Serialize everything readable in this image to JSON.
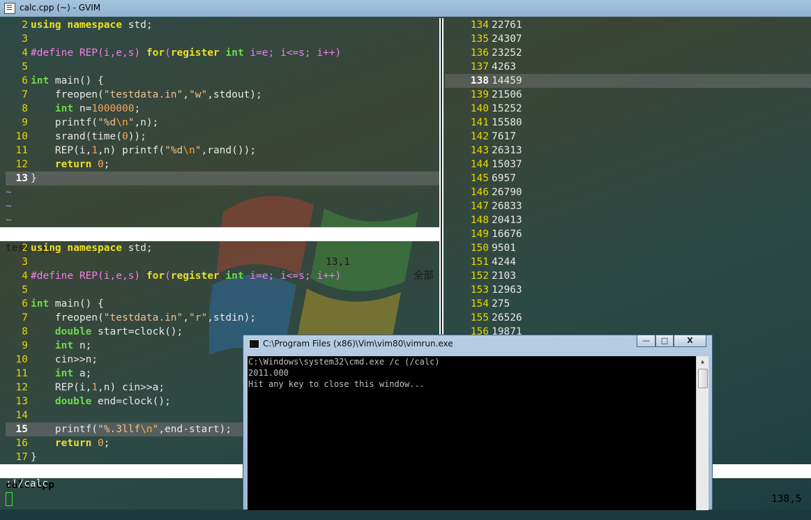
{
  "window": {
    "title": "calc.cpp (~) - GVIM"
  },
  "top_pane": {
    "lines": [
      {
        "n": "2",
        "tokens": [
          [
            "kw",
            "using"
          ],
          [
            "",
            " "
          ],
          [
            "kw",
            "namespace"
          ],
          [
            "",
            " std;"
          ]
        ]
      },
      {
        "n": "3",
        "tokens": []
      },
      {
        "n": "4",
        "tokens": [
          [
            "pp",
            "#define REP(i,e,s)"
          ],
          [
            "",
            " "
          ],
          [
            "kw",
            "for"
          ],
          [
            "pp",
            "("
          ],
          [
            "kw",
            "register"
          ],
          [
            "",
            " "
          ],
          [
            "ty",
            "int"
          ],
          [
            "pp",
            " i=e; i<=s; i++)"
          ]
        ]
      },
      {
        "n": "5",
        "tokens": []
      },
      {
        "n": "6",
        "tokens": [
          [
            "ty",
            "int"
          ],
          [
            "",
            " main() {"
          ]
        ]
      },
      {
        "n": "7",
        "tokens": [
          [
            "",
            "    freopen("
          ],
          [
            "str",
            "\"testdata.in\""
          ],
          [
            "",
            ","
          ],
          [
            "str",
            "\"w\""
          ],
          [
            "",
            ",stdout);"
          ]
        ]
      },
      {
        "n": "8",
        "tokens": [
          [
            "",
            "    "
          ],
          [
            "ty",
            "int"
          ],
          [
            "",
            " n="
          ],
          [
            "num",
            "1000000"
          ],
          [
            "",
            ";"
          ]
        ]
      },
      {
        "n": "9",
        "tokens": [
          [
            "",
            "    printf("
          ],
          [
            "str",
            "\"%d"
          ],
          [
            "esc",
            "\\n"
          ],
          [
            "str",
            "\""
          ],
          [
            "",
            ",n);"
          ]
        ]
      },
      {
        "n": "10",
        "tokens": [
          [
            "",
            "    srand(time("
          ],
          [
            "num",
            "0"
          ],
          [
            "",
            "));"
          ]
        ]
      },
      {
        "n": "11",
        "tokens": [
          [
            "",
            "    REP(i,"
          ],
          [
            "num",
            "1"
          ],
          [
            "",
            ",n) printf("
          ],
          [
            "str",
            "\"%d"
          ],
          [
            "esc",
            "\\n"
          ],
          [
            "str",
            "\""
          ],
          [
            "",
            ",rand());"
          ]
        ]
      },
      {
        "n": "12",
        "tokens": [
          [
            "",
            "    "
          ],
          [
            "kw",
            "return"
          ],
          [
            "",
            " "
          ],
          [
            "num",
            "0"
          ],
          [
            "",
            ";"
          ]
        ]
      },
      {
        "n": "13",
        "cur": true,
        "tokens": [
          [
            "",
            "}"
          ]
        ]
      }
    ],
    "tildes": [
      "~",
      "~",
      "~"
    ],
    "status": {
      "file": "test.cpp",
      "pos": "13,1",
      "all": "全部"
    }
  },
  "bottom_pane": {
    "lines": [
      {
        "n": "2",
        "tokens": [
          [
            "kw",
            "using"
          ],
          [
            "",
            " "
          ],
          [
            "kw",
            "namespace"
          ],
          [
            "",
            " std;"
          ]
        ]
      },
      {
        "n": "3",
        "tokens": []
      },
      {
        "n": "4",
        "tokens": [
          [
            "pp",
            "#define REP(i,e,s)"
          ],
          [
            "",
            " "
          ],
          [
            "kw",
            "for"
          ],
          [
            "pp",
            "("
          ],
          [
            "kw",
            "register"
          ],
          [
            "",
            " "
          ],
          [
            "ty",
            "int"
          ],
          [
            "pp",
            " i=e; i<=s; i++)"
          ]
        ]
      },
      {
        "n": "5",
        "tokens": []
      },
      {
        "n": "6",
        "tokens": [
          [
            "ty",
            "int"
          ],
          [
            "",
            " main() {"
          ]
        ]
      },
      {
        "n": "7",
        "tokens": [
          [
            "",
            "    freopen("
          ],
          [
            "str",
            "\"testdata.in\""
          ],
          [
            "",
            ","
          ],
          [
            "str",
            "\"r\""
          ],
          [
            "",
            ",stdin);"
          ]
        ]
      },
      {
        "n": "8",
        "tokens": [
          [
            "",
            "    "
          ],
          [
            "ty",
            "double"
          ],
          [
            "",
            " start=clock();"
          ]
        ]
      },
      {
        "n": "9",
        "tokens": [
          [
            "",
            "    "
          ],
          [
            "ty",
            "int"
          ],
          [
            "",
            " n;"
          ]
        ]
      },
      {
        "n": "10",
        "tokens": [
          [
            "",
            "    cin>>n;"
          ]
        ]
      },
      {
        "n": "11",
        "tokens": [
          [
            "",
            "    "
          ],
          [
            "ty",
            "int"
          ],
          [
            "",
            " a;"
          ]
        ]
      },
      {
        "n": "12",
        "tokens": [
          [
            "",
            "    REP(i,"
          ],
          [
            "num",
            "1"
          ],
          [
            "",
            ",n) cin>>a;"
          ]
        ]
      },
      {
        "n": "13",
        "tokens": [
          [
            "",
            "    "
          ],
          [
            "ty",
            "double"
          ],
          [
            "",
            " end=clock();"
          ]
        ]
      },
      {
        "n": "14",
        "tokens": []
      },
      {
        "n": "15",
        "cur": true,
        "tokens": [
          [
            "",
            "    printf("
          ],
          [
            "str",
            "\"%.3llf"
          ],
          [
            "esc",
            "\\n"
          ],
          [
            "str",
            "\""
          ],
          [
            "",
            ",end-start);"
          ]
        ]
      },
      {
        "n": "16",
        "tokens": [
          [
            "",
            "    "
          ],
          [
            "kw",
            "return"
          ],
          [
            "",
            " "
          ],
          [
            "num",
            "0"
          ],
          [
            "",
            ";"
          ]
        ]
      },
      {
        "n": "17",
        "tokens": [
          [
            "",
            "}"
          ]
        ]
      }
    ],
    "status": {
      "file": "calc.cpp"
    }
  },
  "right_pane": {
    "lines": [
      {
        "n": "134",
        "v": "22761"
      },
      {
        "n": "135",
        "v": "24307"
      },
      {
        "n": "136",
        "v": "23252"
      },
      {
        "n": "137",
        "v": "4263"
      },
      {
        "n": "138",
        "v": "14459",
        "cur": true
      },
      {
        "n": "139",
        "v": "21506"
      },
      {
        "n": "140",
        "v": "15252"
      },
      {
        "n": "141",
        "v": "15580"
      },
      {
        "n": "142",
        "v": "7617"
      },
      {
        "n": "143",
        "v": "26313"
      },
      {
        "n": "144",
        "v": "15037"
      },
      {
        "n": "145",
        "v": "6957"
      },
      {
        "n": "146",
        "v": "26790"
      },
      {
        "n": "147",
        "v": "26833"
      },
      {
        "n": "148",
        "v": "20413"
      },
      {
        "n": "149",
        "v": "16676"
      },
      {
        "n": "150",
        "v": "9501"
      },
      {
        "n": "151",
        "v": "4244"
      },
      {
        "n": "152",
        "v": "2103"
      },
      {
        "n": "153",
        "v": "12963"
      },
      {
        "n": "154",
        "v": "275"
      },
      {
        "n": "155",
        "v": "26526"
      },
      {
        "n": "156",
        "v": "19871"
      }
    ],
    "status": {
      "pos": "138,5"
    }
  },
  "command_line": ":!/calc",
  "cmd_window": {
    "title": "C:\\Program Files (x86)\\Vim\\vim80\\vimrun.exe",
    "min_label": "—",
    "max_label": "□",
    "close_label": "X",
    "output": [
      "C:\\Windows\\system32\\cmd.exe /c (/calc)",
      "2011.000",
      "Hit any key to close this window..."
    ]
  },
  "colors": {
    "linenr": "#e7d800",
    "keyword": "#e9e028",
    "type": "#6ddb48",
    "preproc": "#f47ee8",
    "string": "#f0c090",
    "number": "#f5a45a"
  }
}
